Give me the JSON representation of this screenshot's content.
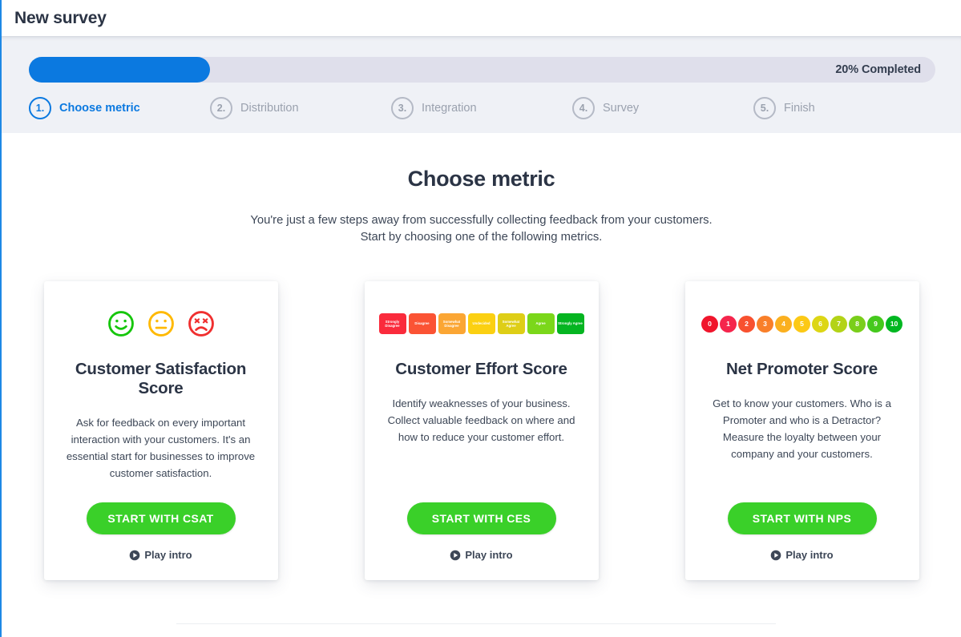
{
  "window": {
    "title": "New survey"
  },
  "progress": {
    "percent": 20,
    "label": "20% Completed",
    "fill_color": "#0b79e0",
    "track_color": "#dfdfeb"
  },
  "steps": [
    {
      "number": "1.",
      "label": "Choose metric",
      "active": true
    },
    {
      "number": "2.",
      "label": "Distribution",
      "active": false
    },
    {
      "number": "3.",
      "label": "Integration",
      "active": false
    },
    {
      "number": "4.",
      "label": "Survey",
      "active": false
    },
    {
      "number": "5.",
      "label": "Finish",
      "active": false
    }
  ],
  "main": {
    "title": "Choose metric",
    "subtitle_line1": "You're just a few steps away from successfully collecting feedback from your customers.",
    "subtitle_line2": "Start by choosing one of the following metrics."
  },
  "cards": [
    {
      "id": "csat",
      "icon_type": "faces",
      "faces": [
        {
          "name": "happy-face-icon",
          "mood": "happy",
          "color": "#16c60c"
        },
        {
          "name": "neutral-face-icon",
          "mood": "neutral",
          "color": "#ffb900"
        },
        {
          "name": "sad-face-icon",
          "mood": "sad",
          "color": "#f02f2f"
        }
      ],
      "title": "Customer Satisfaction Score",
      "description": "Ask for feedback on every important interaction with your customers. It's an essential start for businesses to improve customer satisfaction.",
      "button_label": "START WITH CSAT",
      "play_label": "Play intro"
    },
    {
      "id": "ces",
      "icon_type": "chips",
      "chips": [
        {
          "label": "Strongly Disagree",
          "color": "#fa2b3c"
        },
        {
          "label": "Disagree",
          "color": "#fb5334"
        },
        {
          "label": "Somewhat Disagree",
          "color": "#fba634"
        },
        {
          "label": "Undecided",
          "color": "#fbd012"
        },
        {
          "label": "Somewhat Agree",
          "color": "#dece16"
        },
        {
          "label": "Agree",
          "color": "#7bd71a"
        },
        {
          "label": "Strongly Agree",
          "color": "#05b521"
        }
      ],
      "title": "Customer Effort Score",
      "description": "Identify weaknesses of your business. Collect valuable feedback on where and how to reduce your customer effort.",
      "button_label": "START WITH CES",
      "play_label": "Play intro"
    },
    {
      "id": "nps",
      "icon_type": "nps",
      "nps": [
        {
          "label": "0",
          "color": "#f0152c"
        },
        {
          "label": "1",
          "color": "#f5254c"
        },
        {
          "label": "2",
          "color": "#f8512f"
        },
        {
          "label": "3",
          "color": "#f97f29"
        },
        {
          "label": "4",
          "color": "#fbb01f"
        },
        {
          "label": "5",
          "color": "#fcc915"
        },
        {
          "label": "6",
          "color": "#ddd615"
        },
        {
          "label": "7",
          "color": "#b3d317"
        },
        {
          "label": "8",
          "color": "#7ace1a"
        },
        {
          "label": "9",
          "color": "#45c91d"
        },
        {
          "label": "10",
          "color": "#00b721"
        }
      ],
      "title": "Net Promoter Score",
      "description": "Get to know your customers. Who is a Promoter and who is a Detractor? Measure the loyalty between your company and your customers.",
      "button_label": "START WITH NPS",
      "play_label": "Play intro"
    }
  ],
  "theme": {
    "accent_blue": "#0b79e0",
    "button_green": "#3ad029",
    "band_background": "#eff1f6",
    "text_dark": "#2b3445",
    "text_muted": "#9aa1ae"
  }
}
